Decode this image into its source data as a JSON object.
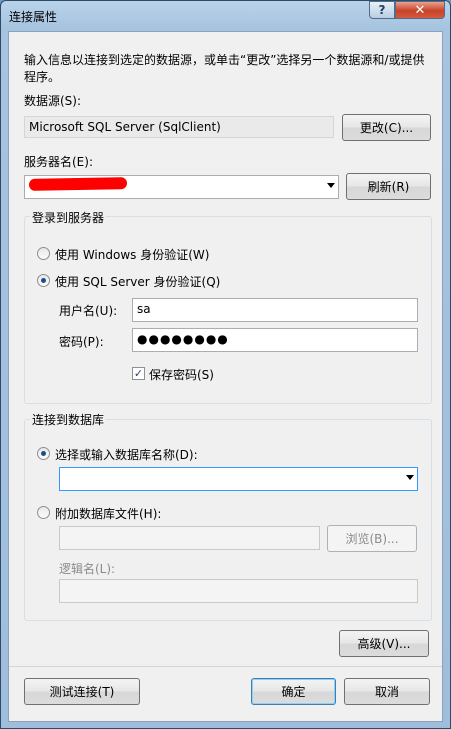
{
  "window": {
    "title": "连接属性",
    "help_label": "?",
    "close_label": "✕"
  },
  "description": "输入信息以连接到选定的数据源，或单击“更改”选择另一个数据源和/或提供程序。",
  "datasource": {
    "label": "数据源(S):",
    "value": "Microsoft SQL Server (SqlClient)",
    "change_button": "更改(C)..."
  },
  "server": {
    "label": "服务器名(E):",
    "value": "",
    "refresh_button": "刷新(R)"
  },
  "login": {
    "group_title": "登录到服务器",
    "windows_auth": "使用 Windows 身份验证(W)",
    "sql_auth": "使用 SQL Server 身份验证(Q)",
    "sql_auth_selected": true,
    "username_label": "用户名(U):",
    "username_value": "sa",
    "password_label": "密码(P):",
    "password_value": "●●●●●●●●",
    "save_password": "保存密码(S)",
    "save_password_checked": true
  },
  "database": {
    "group_title": "连接到数据库",
    "select_option": "选择或输入数据库名称(D):",
    "select_value": "",
    "attach_option": "附加数据库文件(H):",
    "attach_value": "",
    "browse_button": "浏览(B)...",
    "logical_name_label": "逻辑名(L):",
    "logical_name_value": ""
  },
  "buttons": {
    "advanced": "高级(V)...",
    "test_connection": "测试连接(T)",
    "ok": "确定",
    "cancel": "取消"
  }
}
